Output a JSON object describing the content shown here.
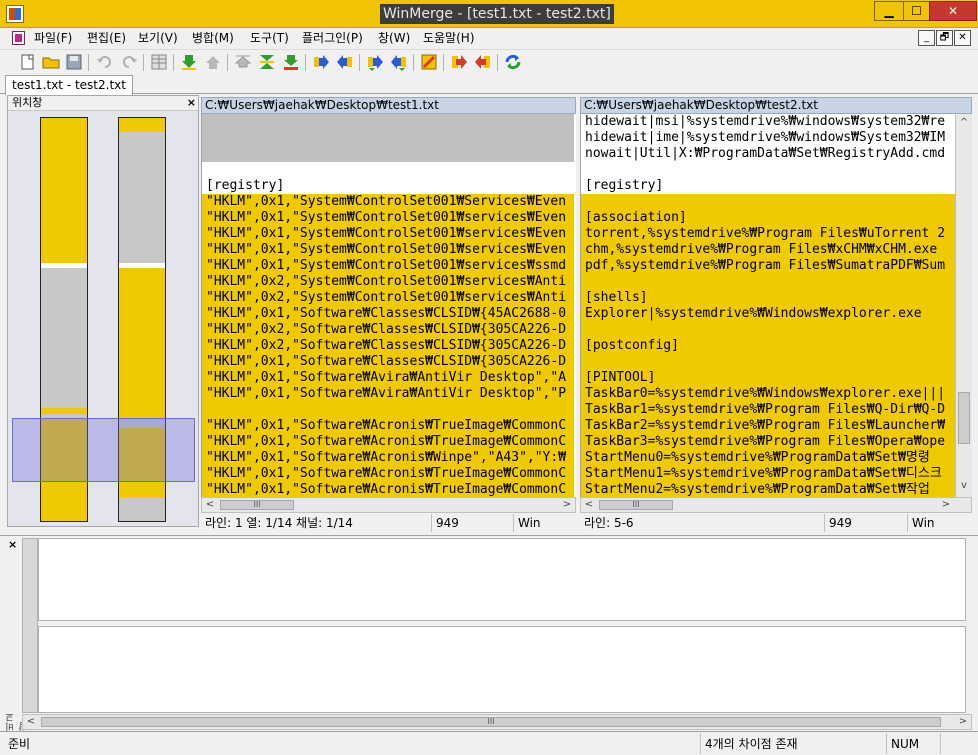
{
  "window": {
    "title": "WinMerge - [test1.txt - test2.txt]"
  },
  "menu": {
    "items": [
      "파일(F)",
      "편집(E)",
      "보기(V)",
      "병합(M)",
      "도구(T)",
      "플러그인(P)",
      "창(W)",
      "도움말(H)"
    ],
    "mdi_min": "_",
    "mdi_restore": "🗗",
    "mdi_close": "✕"
  },
  "toolbar": {
    "icons": [
      "new-icon",
      "open-icon",
      "save-icon",
      "undo-icon",
      "redo-icon",
      "toggle-view-icon",
      "next-diff-icon",
      "prev-diff-icon",
      "first-diff-icon",
      "current-diff-icon",
      "last-diff-icon",
      "copy-right-icon",
      "copy-left-icon",
      "copy-right-advance-icon",
      "copy-left-advance-icon",
      "options-icon",
      "all-right-icon",
      "all-left-icon",
      "refresh-icon"
    ],
    "colors": {
      "green": "#2f9e2f",
      "yellow": "#f2c200",
      "red": "#d83a2a",
      "blue": "#2a5bd8"
    }
  },
  "tabs": [
    {
      "label": "test1.txt - test2.txt"
    }
  ],
  "location_pane": {
    "title": "위치창",
    "close": "×",
    "colors": {
      "diff": "#efca00",
      "same": "#c8c8c8",
      "blank": "#ffffff",
      "viewport": "#6b6bd8"
    }
  },
  "left_pane": {
    "path": "C:₩Users₩jaehak₩Desktop₩test1.txt",
    "lines": [
      {
        "type": "blank",
        "text": ""
      },
      {
        "type": "blank",
        "text": ""
      },
      {
        "type": "blank",
        "text": ""
      },
      {
        "type": "norm",
        "text": ""
      },
      {
        "type": "norm",
        "text": "[registry]"
      },
      {
        "type": "diff",
        "text": "\"HKLM\",0x1,\"System₩ControlSet001₩Services₩Even"
      },
      {
        "type": "diff",
        "text": "\"HKLM\",0x1,\"System₩ControlSet001₩services₩Even"
      },
      {
        "type": "diff",
        "text": "\"HKLM\",0x1,\"System₩ControlSet001₩services₩Even"
      },
      {
        "type": "diff",
        "text": "\"HKLM\",0x1,\"System₩ControlSet001₩services₩Even"
      },
      {
        "type": "diff",
        "text": "\"HKLM\",0x1,\"System₩ControlSet001₩services₩ssmd"
      },
      {
        "type": "diff",
        "text": "\"HKLM\",0x2,\"System₩ControlSet001₩services₩Anti"
      },
      {
        "type": "diff",
        "text": "\"HKLM\",0x2,\"System₩ControlSet001₩services₩Anti"
      },
      {
        "type": "diff",
        "text": "\"HKLM\",0x1,\"Software₩Classes₩CLSID₩{45AC2688-0"
      },
      {
        "type": "diff",
        "text": "\"HKLM\",0x2,\"Software₩Classes₩CLSID₩{305CA226-D"
      },
      {
        "type": "diff",
        "text": "\"HKLM\",0x2,\"Software₩Classes₩CLSID₩{305CA226-D"
      },
      {
        "type": "diff",
        "text": "\"HKLM\",0x1,\"Software₩Classes₩CLSID₩{305CA226-D"
      },
      {
        "type": "diff",
        "text": "\"HKLM\",0x1,\"Software₩Avira₩AntiVir Desktop\",\"A"
      },
      {
        "type": "diff",
        "text": "\"HKLM\",0x1,\"Software₩Avira₩AntiVir Desktop\",\"P"
      },
      {
        "type": "diff",
        "text": ""
      },
      {
        "type": "diff",
        "text": "\"HKLM\",0x1,\"Software₩Acronis₩TrueImage₩CommonC"
      },
      {
        "type": "diff",
        "text": "\"HKLM\",0x1,\"Software₩Acronis₩TrueImage₩CommonC"
      },
      {
        "type": "diff",
        "text": "\"HKLM\",0x1,\"Software₩Acronis₩Winpe\",\"A43\",\"Y:₩"
      },
      {
        "type": "diff",
        "text": "\"HKLM\",0x1,\"Software₩Acronis₩TrueImage₩CommonC"
      },
      {
        "type": "diff",
        "text": "\"HKLM\",0x1,\"Software₩Acronis₩TrueImage₩CommonC"
      }
    ]
  },
  "right_pane": {
    "path": "C:₩Users₩jaehak₩Desktop₩test2.txt",
    "lines": [
      {
        "type": "norm",
        "text": "hidewait|msi|%systemdrive%₩windows₩system32₩re"
      },
      {
        "type": "norm",
        "text": "hidewait|ime|%systemdrive%₩windows₩System32₩IM"
      },
      {
        "type": "norm",
        "text": "nowait|Util|X:₩ProgramData₩Set₩RegistryAdd.cmd"
      },
      {
        "type": "norm",
        "text": ""
      },
      {
        "type": "norm",
        "text": "[registry]"
      },
      {
        "type": "diff",
        "text": ""
      },
      {
        "type": "diff",
        "text": "[association]"
      },
      {
        "type": "diff",
        "text": "torrent,%systemdrive%₩Program Files₩uTorrent 2"
      },
      {
        "type": "diff",
        "text": "chm,%systemdrive%₩Program Files₩xCHM₩xCHM.exe"
      },
      {
        "type": "diff",
        "text": "pdf,%systemdrive%₩Program Files₩SumatraPDF₩Sum"
      },
      {
        "type": "diff",
        "text": ""
      },
      {
        "type": "diff",
        "text": "[shells]"
      },
      {
        "type": "diff",
        "text": "Explorer|%systemdrive%₩Windows₩explorer.exe"
      },
      {
        "type": "diff",
        "text": ""
      },
      {
        "type": "diff",
        "text": "[postconfig]"
      },
      {
        "type": "diff",
        "text": ""
      },
      {
        "type": "diff",
        "text": "[PINTOOL]"
      },
      {
        "type": "diff",
        "text": "TaskBar0=%systemdrive%₩Windows₩explorer.exe|||"
      },
      {
        "type": "diff",
        "text": "TaskBar1=%systemdrive%₩Program Files₩Q-Dir₩Q-D"
      },
      {
        "type": "diff",
        "text": "TaskBar2=%systemdrive%₩Program Files₩Launcher₩"
      },
      {
        "type": "diff",
        "text": "TaskBar3=%systemdrive%₩Program Files₩Opera₩ope"
      },
      {
        "type": "diff",
        "text": "StartMenu0=%systemdrive%₩ProgramData₩Set₩명령"
      },
      {
        "type": "diff",
        "text": "StartMenu1=%systemdrive%₩ProgramData₩Set₩디스크"
      },
      {
        "type": "diff",
        "text": "StartMenu2=%systemdrive%₩ProgramData₩Set₩작업"
      }
    ]
  },
  "left_status": {
    "position": "라인: 1  열: 1/14  채널: 1/14",
    "codepage": "949",
    "eol": "Win"
  },
  "right_status": {
    "position": "라인: 5-6",
    "codepage": "949",
    "eol": "Win"
  },
  "diff_pane": {
    "label": "비교창",
    "close": "×"
  },
  "statusbar": {
    "ready": "준비",
    "diff_count": "4개의 차이점 존재",
    "num": "NUM"
  },
  "scroll": {
    "left_arrow": "<",
    "right_arrow": ">",
    "up_arrow": "^",
    "down_arrow": "v",
    "thumb": "III"
  }
}
